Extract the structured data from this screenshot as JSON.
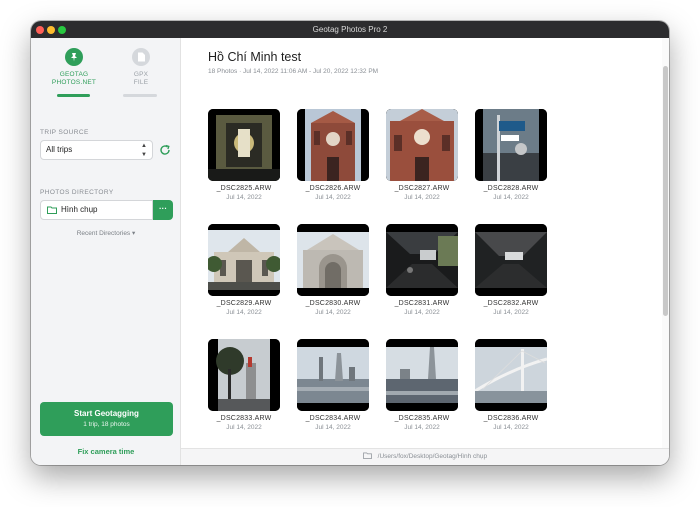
{
  "window": {
    "title": "Geotag Photos Pro 2"
  },
  "sidebar": {
    "sources": [
      {
        "label_line1": "GEOTAG",
        "label_line2": "PHOTOS.NET",
        "icon": "pin-icon",
        "active": true
      },
      {
        "label_line1": "GPX",
        "label_line2": "FILE",
        "icon": "file-icon",
        "active": false
      }
    ],
    "trip_source_label": "TRIP SOURCE",
    "trip_select_value": "All trips",
    "photos_directory_label": "PHOTOS DIRECTORY",
    "directory_name": "Hình chụp",
    "directory_more": "···",
    "recent_directories": "Recent Directories ▾",
    "start_button": {
      "label": "Start Geotagging",
      "sub": "1 trip, 18 photos"
    },
    "fix_camera_time": "Fix camera time"
  },
  "album": {
    "title": "Hồ Chí Minh test",
    "meta": "18 Photos · Jul 14, 2022 11:06 AM - Jul 20, 2022 12:32 PM"
  },
  "photos": [
    {
      "name": "_DSC2825.ARW",
      "date": "Jul 14, 2022",
      "scene": "interior"
    },
    {
      "name": "_DSC2826.ARW",
      "date": "Jul 14, 2022",
      "scene": "cathedral"
    },
    {
      "name": "_DSC2827.ARW",
      "date": "Jul 14, 2022",
      "scene": "cathedral2"
    },
    {
      "name": "_DSC2828.ARW",
      "date": "Jul 14, 2022",
      "scene": "street"
    },
    {
      "name": "_DSC2829.ARW",
      "date": "Jul 14, 2022",
      "scene": "building"
    },
    {
      "name": "_DSC2830.ARW",
      "date": "Jul 14, 2022",
      "scene": "arch"
    },
    {
      "name": "_DSC2831.ARW",
      "date": "Jul 14, 2022",
      "scene": "tunnel"
    },
    {
      "name": "_DSC2832.ARW",
      "date": "Jul 14, 2022",
      "scene": "tunnel2"
    },
    {
      "name": "_DSC2833.ARW",
      "date": "Jul 14, 2022",
      "scene": "tree"
    },
    {
      "name": "_DSC2834.ARW",
      "date": "Jul 14, 2022",
      "scene": "river"
    },
    {
      "name": "_DSC2835.ARW",
      "date": "Jul 14, 2022",
      "scene": "river2"
    },
    {
      "name": "_DSC2836.ARW",
      "date": "Jul 14, 2022",
      "scene": "bridge"
    },
    {
      "name": "",
      "date": "",
      "scene": "partial-dark"
    },
    {
      "name": "",
      "date": "",
      "scene": "partial-sky"
    },
    {
      "name": "",
      "date": "",
      "scene": "partial-sky2"
    },
    {
      "name": "",
      "date": "",
      "scene": "partial-tree"
    }
  ],
  "statusbar": {
    "path": "/Users/fox/Desktop/Geotag/Hình chụp"
  },
  "colors": {
    "accent": "#2f9e5a"
  }
}
